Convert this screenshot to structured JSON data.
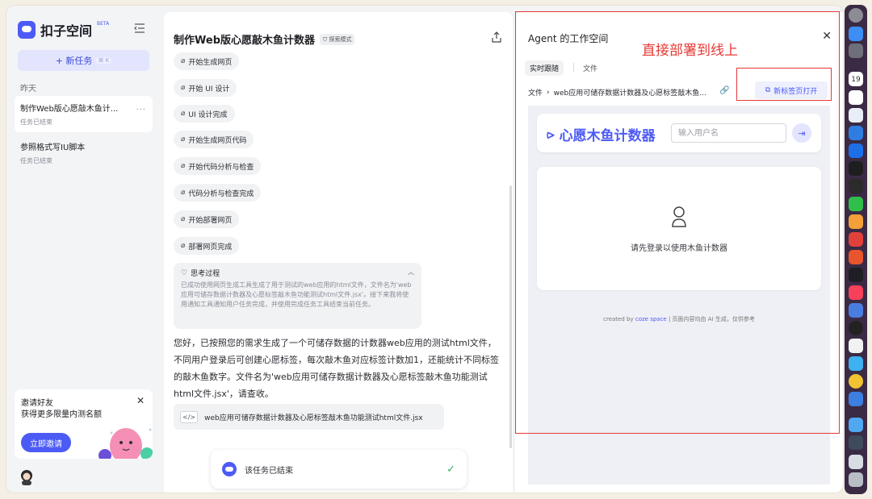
{
  "app": {
    "name": "扣子空间",
    "beta": "BETA"
  },
  "sidebar": {
    "new_task_label": "+ 新任务",
    "new_task_shortcut": "⌘ K",
    "section_label": "昨天",
    "tasks": [
      {
        "title": "制作Web版心愿敲木鱼计...",
        "status": "任务已结束"
      },
      {
        "title": "参照格式写IU脚本",
        "status": "任务已结束"
      }
    ],
    "invite": {
      "title": "邀请好友",
      "subtitle": "获得更多限量内测名额",
      "button": "立即邀请"
    }
  },
  "chat": {
    "title": "制作Web版心愿敲木鱼计数器",
    "mode_badge": "探索模式",
    "steps": [
      "开始生成网页",
      "开始 UI 设计",
      "UI 设计完成",
      "开始生成网页代码",
      "开始代码分析与检查",
      "代码分析与检查完成",
      "开始部署网页",
      "部署网页完成"
    ],
    "thinking": {
      "title": "思考过程",
      "body": "已成功使用网页生成工具生成了用于测试的web应用的html文件，文件名为'web应用可储存数据计数器及心愿标签敲木鱼功能测试html文件.jsx'。接下来我将使用通知工具通知用户任务完成，并使用完成任务工具结束当前任务。"
    },
    "reply": "您好，已按照您的需求生成了一个可储存数据的计数器web应用的测试html文件，不同用户登录后可创建心愿标签，每次敲木鱼对应标签计数加1，还能统计不同标签的敲木鱼数字。文件名为'web应用可储存数据计数器及心愿标签敲木鱼功能测试html文件.jsx'，请查收。",
    "file_name": "web应用可储存数据计数器及心愿标签敲木鱼功能测试html文件.jsx",
    "done_text": "该任务已结束"
  },
  "workspace": {
    "title": "Agent 的工作空间",
    "tabs": [
      "实时跟随",
      "文件"
    ],
    "breadcrumb_root": "文件",
    "breadcrumb_file": "web应用可储存数据计数器及心愿标签敲木鱼...",
    "open_new_tab": "新标签页打开",
    "preview": {
      "app_title": "心愿木鱼计数器",
      "username_placeholder": "输入用户名",
      "login_hint": "请先登录以使用木鱼计数器",
      "credit_prefix": "created by",
      "credit_brand": "coze space",
      "credit_suffix": "| 页面内容均由 AI 生成，仅供参考"
    }
  },
  "annotation": {
    "text": "直接部署到线上",
    "color": "#e53935"
  },
  "colors": {
    "accent": "#4d5bf5",
    "accent_light": "#e2e5fd",
    "success": "#33b35a"
  },
  "dock_icons": [
    "settings-icon",
    "finder-icon",
    "launchpad-icon",
    "calendar-icon",
    "reminders-icon",
    "mail-icon",
    "browser-icon",
    "safari-icon",
    "terminal-icon",
    "figma-icon",
    "wechat-icon",
    "sublime-icon",
    "wps-icon",
    "notes-icon",
    "app-icon",
    "music-icon",
    "search-icon",
    "obs-icon",
    "panda-icon",
    "cloud-icon",
    "chrome-icon",
    "xcode-icon",
    "files-icon",
    "screenshot-icon",
    "preview-icon",
    "trash-icon"
  ],
  "calendar_day": "19"
}
